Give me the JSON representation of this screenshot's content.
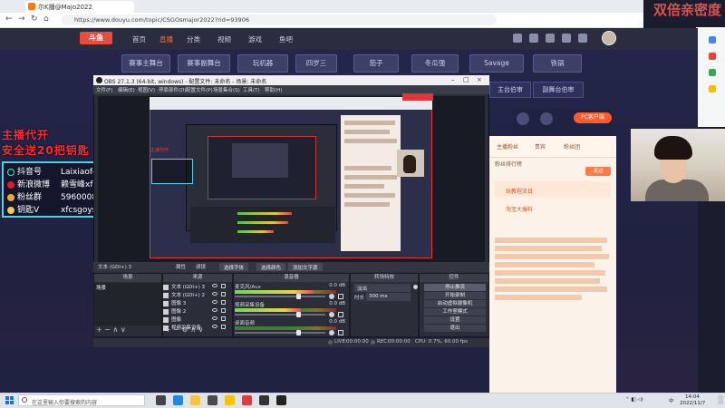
{
  "browser": {
    "tab_title": "双倍亲密度",
    "tab_label": "尔K播@Majo2022",
    "url": "https://www.douyu.com/topic/CSGOsmajor2022?rid=93906",
    "nav_back": "←",
    "nav_forward": "→",
    "nav_reload": "↻",
    "nav_home": "⌂"
  },
  "overlay": {
    "top_right_title": "双倍亲密度",
    "promo_line1": "主播代开",
    "promo_line2": "安全送20把钥匙",
    "social": [
      {
        "icon": "douyin-icon",
        "label": "抖音号",
        "value": "Laixiaofeng",
        "color": "#111111"
      },
      {
        "icon": "weibo-icon",
        "label": "新浪微博",
        "value": "赖雪峰xf",
        "color": "#e6162d"
      },
      {
        "icon": "fans-icon",
        "label": "粉丝群",
        "value": "5960008",
        "color": "#f5a623"
      },
      {
        "icon": "key-icon",
        "label": "钥匙V",
        "value": "xfcsgoys1",
        "color": "#f2c94c"
      }
    ]
  },
  "site": {
    "logo": "斗鱼",
    "nav": [
      "首页",
      "直播",
      "分类",
      "视频",
      "游戏",
      "鱼吧"
    ],
    "active_nav": "直播",
    "game_buttons": [
      "赛事主舞台",
      "赛事副舞台",
      "玩机器",
      "四岁三",
      "茄子",
      "冬瓜强",
      "Savage",
      "铁锅"
    ],
    "game_buttons_row2": [
      "主台伯审",
      "副舞台伯审"
    ],
    "pc_button": "PC客户端",
    "chat_tabs": [
      "主播粉丝",
      "贵宾",
      "粉丝团"
    ],
    "chat_rank_label": "粉丝排行榜",
    "chat_banner1": "玩教程流日",
    "chat_banner2": "淘宝大爆料",
    "chat_send": "发送"
  },
  "obs": {
    "title": "OBS 27.1.3 (64-bit, windows) - 配置文件: 未命名 - 场景: 未命名",
    "menu": [
      "文件(F)",
      "编辑(E)",
      "视图(V)",
      "停靠部件(D)",
      "配置文件(P)",
      "场景集合(S)",
      "工具(T)",
      "帮助(H)"
    ],
    "toolbar": {
      "selected_source": "文本 (GDI+) 3",
      "properties": "属性",
      "filters": "滤镜",
      "btn1": "选择字体",
      "btn2": "选择颜色",
      "btn3": "添加文字源"
    },
    "docks": {
      "scenes": "场景",
      "sources": "来源",
      "mixer": "混音器",
      "transitions": "转场特效",
      "controls": "控件"
    },
    "scenes_list": [
      "场景"
    ],
    "sources_list": [
      "文本 (GDI+) 3",
      "文本 (GDI+) 2",
      "图像 3",
      "图像 2",
      "图像",
      "视频采集设备"
    ],
    "mixer": [
      {
        "name": "麦克风/Aux",
        "db": "0.0 dB",
        "level": 0.78,
        "fader": 0.7
      },
      {
        "name": "视频采集设备",
        "db": "0.0 dB",
        "level": 0.65,
        "fader": 0.7
      },
      {
        "name": "桌面音频",
        "db": "0.0 dB",
        "level": 0.0,
        "fader": 0.7
      }
    ],
    "transition": {
      "type": "淡出",
      "duration_label": "时长",
      "duration": "300 ms"
    },
    "controls": [
      "停止推流",
      "开始录制",
      "启动虚拟摄像机",
      "工作室模式",
      "设置",
      "退出"
    ],
    "status": {
      "live_label": "LIVE:",
      "live_time": "00:00:00",
      "rec_label": "REC:",
      "rec_time": "00:00:00",
      "cpu": "CPU: 0.7%, 60.00 fps"
    }
  },
  "taskbar": {
    "search_placeholder": "在这里输入你要搜索的内容",
    "time": "14:04",
    "date": "2022/11/7",
    "lang": "中",
    "apps": [
      {
        "name": "task-view-icon",
        "color": "#444444"
      },
      {
        "name": "edge-icon",
        "color": "#1e88e5"
      },
      {
        "name": "explorer-icon",
        "color": "#f4c542"
      },
      {
        "name": "store-icon",
        "color": "#4a4a4a"
      },
      {
        "name": "app-yellow-icon",
        "color": "#f5c400"
      },
      {
        "name": "app-red-icon",
        "color": "#e03c3c"
      },
      {
        "name": "app-dark-icon",
        "color": "#333333"
      },
      {
        "name": "obs-icon",
        "color": "#222222"
      }
    ]
  }
}
